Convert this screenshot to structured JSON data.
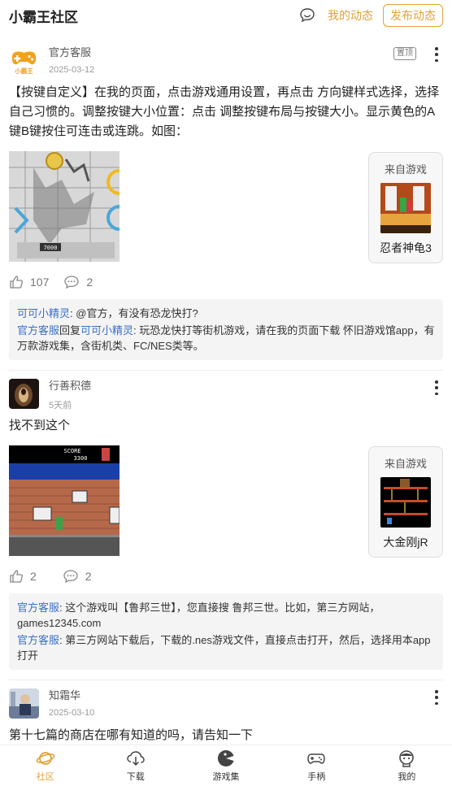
{
  "header": {
    "title": "小霸王社区",
    "my_dynamics": "我的动态",
    "publish": "发布动态"
  },
  "posts": [
    {
      "author": "官方客服",
      "date": "2025-03-12",
      "badge": "置顶",
      "avatar_text": "小霸王",
      "content": "【按键自定义】在我的页面，点击游戏通用设置，再点击 方向键样式选择，选择自己习惯的。调整按键大小位置：点击 调整按键布局与按键大小。显示黄色的A键B键按住可连击或连跳。如图：",
      "screenshot_text": "7000",
      "game_from": "来自游戏",
      "game_name": "忍者神龟3",
      "likes": "107",
      "comment_count": "2",
      "comments": [
        {
          "who": "可可小精灵",
          "sep": ": ",
          "text": "@官方，有没有恐龙快打?"
        },
        {
          "who": "官方客服",
          "reply": "回复",
          "to": "可可小精灵",
          "sep": ": ",
          "text": "玩恐龙快打等街机游戏，请在我的页面下载 怀旧游戏馆app，有万款游戏集，含街机类、FC/NES类等。"
        }
      ]
    },
    {
      "author": "行善积德",
      "date": "5天前",
      "content": "找不到这个",
      "score_label": "SCORE",
      "score_value": "3300",
      "game_from": "来自游戏",
      "game_name": "大金刚jR",
      "likes": "2",
      "comment_count": "2",
      "comments": [
        {
          "who": "官方客服",
          "sep": ": ",
          "text": "这个游戏叫【鲁邦三世】，您直接搜 鲁邦三世。比如，第三方网站，games12345.com"
        },
        {
          "who": "官方客服",
          "sep": ": ",
          "text": "第三方网站下载后，下载的.nes游戏文件，直接点击打开，然后，选择用本app打开"
        }
      ]
    },
    {
      "author": "知霜华",
      "date": "2025-03-10",
      "content": "第十七篇的商店在哪有知道的吗，请告知一下"
    }
  ],
  "tabs": [
    {
      "label": "社区",
      "icon": "planet-icon"
    },
    {
      "label": "下载",
      "icon": "cloud-download-icon"
    },
    {
      "label": "游戏集",
      "icon": "pacman-icon"
    },
    {
      "label": "手柄",
      "icon": "gamepad-icon"
    },
    {
      "label": "我的",
      "icon": "profile-icon"
    }
  ],
  "colors": {
    "accent": "#e2a23a",
    "link": "#3a6fc7"
  }
}
